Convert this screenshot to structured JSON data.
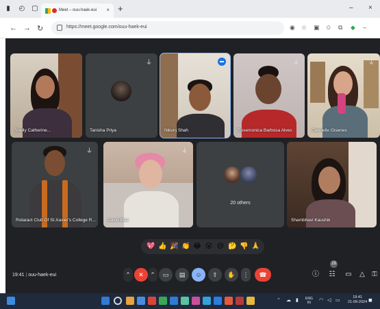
{
  "browser": {
    "tab_title": "Meet – ouu-haek-eui",
    "new_tab_symbol": "+",
    "tab_close_symbol": "×",
    "url": "https://meet.google.com/ouu-haek-eui",
    "minimize_symbol": "–",
    "close_symbol": "×"
  },
  "participants": [
    {
      "name": "Shelly Catherine..."
    },
    {
      "name": "Tanisha Priya"
    },
    {
      "name": "Nikunj Shah"
    },
    {
      "name": "Rosemonica Barbosa Alves"
    },
    {
      "name": "Gabrielle Gisenes"
    },
    {
      "name": "Rotaract Club Of St.Xavier's College R..."
    },
    {
      "name": "David Blaz"
    },
    {
      "name": "Shambhavi Kaushik"
    }
  ],
  "others_tile": {
    "label": "20 others"
  },
  "reactions": [
    "💖",
    "👍",
    "🎉",
    "👏",
    "😂",
    "😮",
    "😢",
    "🤔",
    "👎",
    "🙏"
  ],
  "meeting": {
    "time": "19:41",
    "code": "ouu-haek-eui",
    "people_count": "28"
  },
  "taskbar": {
    "lang_top": "ENG",
    "lang_bottom": "IN",
    "clock_time": "19:41",
    "clock_date": "21-09-2024"
  },
  "colors": {
    "meet_bg": "#202124",
    "tile_bg": "#3c4043",
    "active_outline": "#8ab4f8",
    "hangup": "#ea4335",
    "taskbar": "#1f2a3c"
  },
  "icons": {
    "mic_off": "mic-off-icon",
    "camera": "camera-icon",
    "captions": "captions-icon",
    "emoji": "emoji-icon",
    "present": "present-icon",
    "hand": "raise-hand-icon",
    "more": "more-options-icon",
    "hangup": "hangup-icon",
    "info": "info-icon",
    "people": "people-icon",
    "chat": "chat-icon",
    "activities": "activities-icon"
  }
}
